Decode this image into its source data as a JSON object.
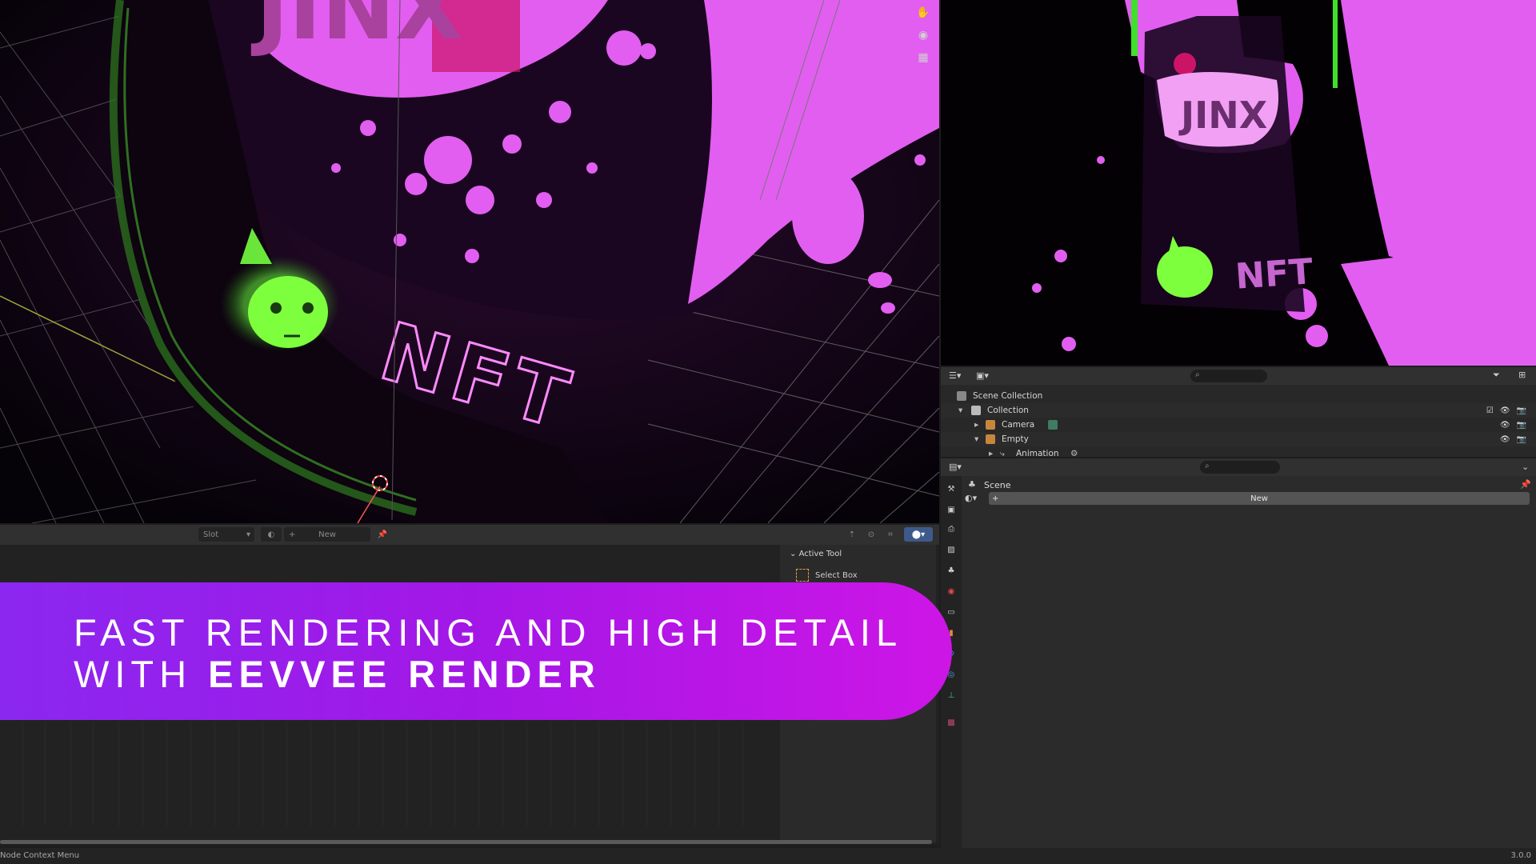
{
  "banner": {
    "line1": "FAST RENDERING AND HIGH DETAIL",
    "line2_prefix": "WITH ",
    "line2_bold": "EEVVEE RENDER",
    "gradient_start": "#8a28f0",
    "gradient_end": "#cd16e6"
  },
  "viewport": {
    "text_jinx": "JINX",
    "text_nft": "NFT",
    "accent_pink": "#e25ef0",
    "accent_green": "#7dff3e"
  },
  "preview": {
    "text_jinx": "JINX",
    "text_nft": "NFT"
  },
  "shader_header": {
    "slot_label": "Slot",
    "new_label": "New"
  },
  "npanel": {
    "section_title": "Active Tool",
    "tool_label": "Select Box"
  },
  "outliner": {
    "rows": [
      {
        "label": "Scene Collection"
      },
      {
        "label": "Collection"
      },
      {
        "label": "Camera"
      },
      {
        "label": "Empty"
      },
      {
        "label": "Animation"
      }
    ]
  },
  "properties": {
    "context_label": "Scene",
    "new_label": "New"
  },
  "status": {
    "left_text": "Node Context Menu",
    "version": "3.0.0"
  }
}
